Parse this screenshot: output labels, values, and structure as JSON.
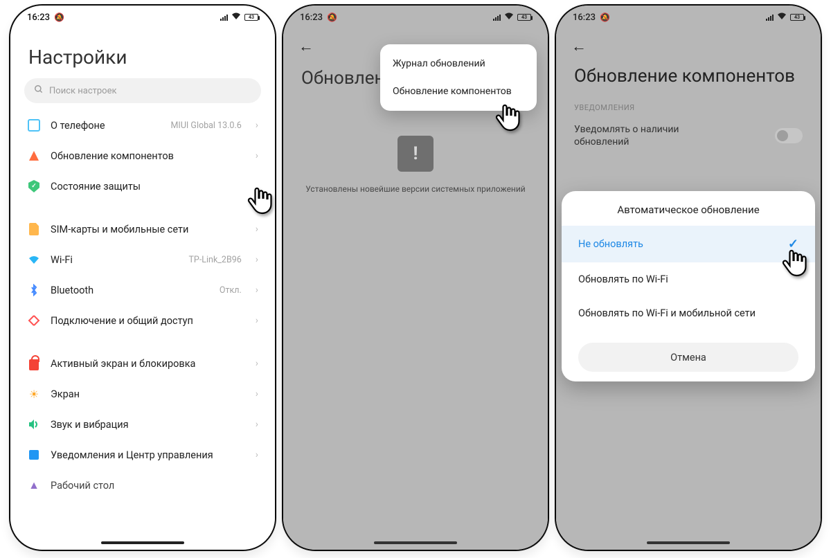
{
  "status": {
    "time": "16:23",
    "battery": "43"
  },
  "screen1": {
    "title": "Настройки",
    "search_placeholder": "Поиск настроек",
    "rows": {
      "about": {
        "label": "О телефоне",
        "value": "MIUI Global 13.0.6"
      },
      "update": {
        "label": "Обновление компонентов"
      },
      "security": {
        "label": "Состояние защиты"
      },
      "sim": {
        "label": "SIM-карты и мобильные сети"
      },
      "wifi": {
        "label": "Wi-Fi",
        "value": "TP-Link_2B96"
      },
      "bt": {
        "label": "Bluetooth",
        "value": "Откл."
      },
      "conn": {
        "label": "Подключение и общий доступ"
      },
      "lock": {
        "label": "Активный экран и блокировка"
      },
      "display": {
        "label": "Экран"
      },
      "sound": {
        "label": "Звук и вибрация"
      },
      "notif": {
        "label": "Уведомления и Центр управления"
      },
      "home": {
        "label": "Рабочий стол"
      }
    }
  },
  "screen2": {
    "title": "Обновлени",
    "message": "Установлены новейшие версии системных приложений",
    "menu": {
      "log": "Журнал обновлений",
      "components": "Обновление компонентов"
    }
  },
  "screen3": {
    "title": "Обновление компонентов",
    "section": "УВЕДОМЛЕНИЯ",
    "notify_row": "Уведомлять о наличии обновлений",
    "sheet": {
      "title": "Автоматическое обновление",
      "opt_none": "Не обновлять",
      "opt_wifi": "Обновлять по Wi-Fi",
      "opt_both": "Обновлять по Wi-Fi и мобильной сети",
      "cancel": "Отмена"
    }
  }
}
